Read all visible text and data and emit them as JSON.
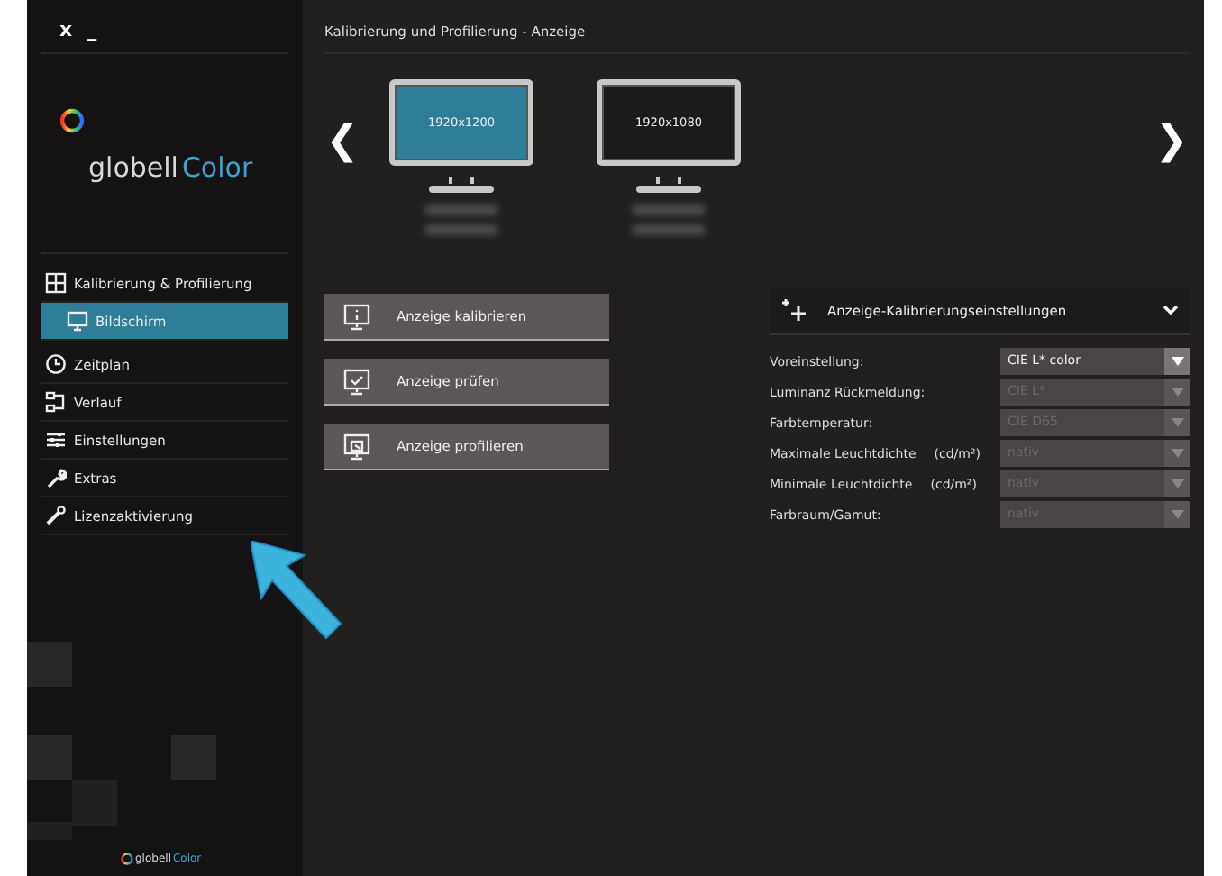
{
  "window": {
    "controls": [
      "x",
      "_"
    ],
    "title": "Kalibrierung und Profilierung - Anzeige"
  },
  "logo": {
    "name": "globell",
    "accent": "Color"
  },
  "sidebar": {
    "items": [
      {
        "label": "Kalibrierung & Profilierung",
        "kind": "grid",
        "selected": false,
        "children": [
          {
            "label": "Bildschirm",
            "kind": "monitor",
            "selected": true
          }
        ]
      },
      {
        "label": "Zeitplan",
        "kind": "clock",
        "selected": false
      },
      {
        "label": "Verlauf",
        "kind": "flow",
        "selected": false
      },
      {
        "label": "Einstellungen",
        "kind": "sliders",
        "selected": false
      },
      {
        "label": "Extras",
        "kind": "wrench",
        "selected": false
      },
      {
        "label": "Lizenzaktivierung",
        "kind": "key",
        "selected": false
      }
    ]
  },
  "footer_logo": {
    "name": "globell",
    "accent": "Color"
  },
  "carousel": {
    "prev": "❮",
    "next": "❯",
    "monitors": [
      {
        "resolution": "1920x1200",
        "selected": true
      },
      {
        "resolution": "1920x1080",
        "selected": false
      }
    ]
  },
  "actions": [
    {
      "label": "Anzeige kalibrieren",
      "kind": "info"
    },
    {
      "label": "Anzeige prüfen",
      "kind": "check"
    },
    {
      "label": "Anzeige profilieren",
      "kind": "profile"
    }
  ],
  "settings": {
    "title": "Anzeige-Kalibrierungseinstellungen",
    "expanded": true,
    "rows": [
      {
        "label": "Voreinstellung:",
        "value": "CIE L* color",
        "disabled": false
      },
      {
        "label": "Luminanz Rückmeldung:",
        "value": "CIE L*",
        "disabled": true
      },
      {
        "label": "Farbtemperatur:",
        "value": "CIE D65",
        "disabled": true
      },
      {
        "label": "Maximale Leuchtdichte",
        "unit": "(cd/m²)",
        "value": "nativ",
        "disabled": true
      },
      {
        "label": "Minimale Leuchtdichte",
        "unit": "(cd/m²)",
        "value": "nativ",
        "disabled": true
      },
      {
        "label": "Farbraum/Gamut:",
        "value": "nativ",
        "disabled": true
      }
    ]
  }
}
